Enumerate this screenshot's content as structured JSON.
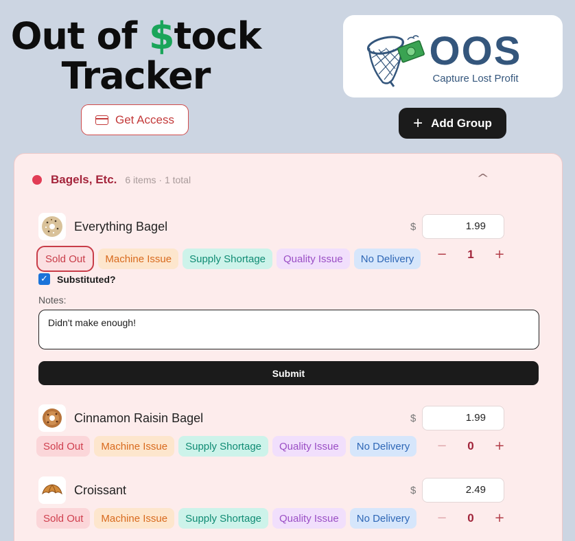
{
  "header": {
    "title_line1_before": "Out of ",
    "title_dollar": "$",
    "title_line1_after": "tock",
    "title_line2": "Tracker",
    "get_access_label": "Get Access",
    "add_group_label": "Add Group"
  },
  "logo": {
    "word": "OOS",
    "tagline": "Capture Lost Profit"
  },
  "group": {
    "name": "Bagels, Etc.",
    "meta": "6 items · 1 total",
    "dot_color": "#e23c55",
    "items": [
      {
        "name": "Everything Bagel",
        "price": "1.99",
        "qty": "1",
        "thumb_icon": "bagel-icon",
        "active_reason": "Sold Out"
      },
      {
        "name": "Cinnamon Raisin Bagel",
        "price": "1.99",
        "qty": "0",
        "thumb_icon": "bagel-icon"
      },
      {
        "name": "Croissant",
        "price": "2.49",
        "qty": "0",
        "thumb_icon": "croissant-icon"
      }
    ]
  },
  "reasons": {
    "sold_out": "Sold Out",
    "machine": "Machine Issue",
    "supply": "Supply Shortage",
    "quality": "Quality Issue",
    "delivery": "No Delivery"
  },
  "stepper": {
    "minus": "−",
    "plus": "+"
  },
  "form": {
    "currency": "$",
    "substituted_label": "Substituted?",
    "substituted_checked": true,
    "notes_label": "Notes:",
    "notes_value": "Didn't make enough!",
    "submit_label": "Submit"
  }
}
